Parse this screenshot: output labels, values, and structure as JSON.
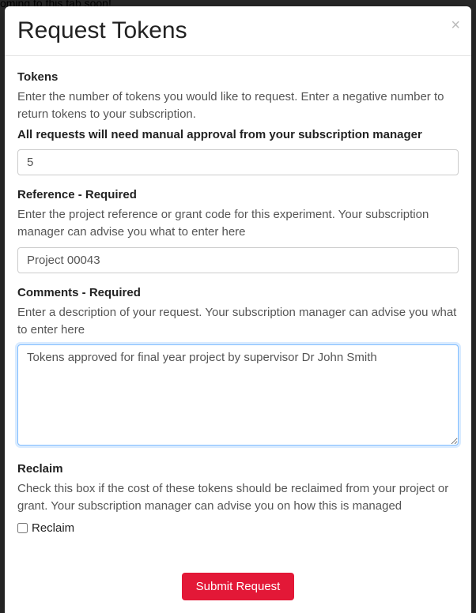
{
  "backdrop_hint": "oming to this tab soon!",
  "modal": {
    "title": "Request Tokens",
    "close_label": "×"
  },
  "tokens": {
    "label": "Tokens",
    "help": "Enter the number of tokens you would like to request. Enter a negative number to return tokens to your subscription.",
    "note": "All requests will need manual approval from your subscription manager",
    "value": "5"
  },
  "reference": {
    "label": "Reference - Required",
    "help": "Enter the project reference or grant code for this experiment. Your subscription manager can advise you what to enter here",
    "value": "Project 00043"
  },
  "comments": {
    "label": "Comments - Required",
    "help": "Enter a description of your request. Your subscription manager can advise you what to enter here",
    "value": "Tokens approved for final year project by supervisor Dr John Smith"
  },
  "reclaim": {
    "label": "Reclaim",
    "help": "Check this box if the cost of these tokens should be reclaimed from your project or grant. Your subscription manager can advise you on how this is managed",
    "checkbox_label": "Reclaim",
    "checked": false
  },
  "submit": {
    "label": "Submit Request"
  }
}
